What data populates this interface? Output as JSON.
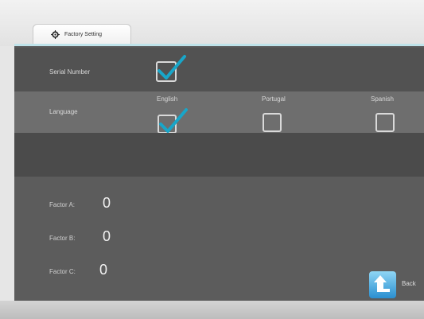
{
  "tab": {
    "label": "Factory Setting",
    "icon": "gear-icon"
  },
  "serial": {
    "label": "Serial Number",
    "checked": true
  },
  "language": {
    "label": "Language",
    "options": [
      {
        "label": "English",
        "checked": true
      },
      {
        "label": "Portugal",
        "checked": false
      },
      {
        "label": "Spanish",
        "checked": false
      }
    ]
  },
  "factors": [
    {
      "label": "Factor A:",
      "value": "0"
    },
    {
      "label": "Factor B:",
      "value": "0"
    },
    {
      "label": "Factor C:",
      "value": "0"
    }
  ],
  "back": {
    "label": "Back",
    "icon": "back-arrow-icon"
  },
  "colors": {
    "accent": "#1fa7c8",
    "checkmark": "#18a6c9"
  }
}
